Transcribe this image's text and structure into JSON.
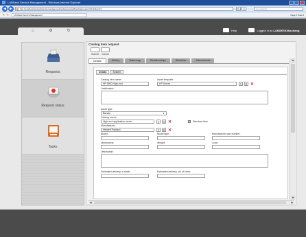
{
  "browser": {
    "window_title": "LANDesk Service Management - Windows Internet Explorer",
    "address": "http://localhost/landesk/servicemanagement/webaccess/wd/ReqStatus.aspx?id=44&ci=21",
    "search_placeholder": "Live Search",
    "tab_title": "LANDesk Service Management",
    "toolbar_right": "Page ▾  Tools ▾"
  },
  "header": {
    "help_label": "Help",
    "logged_in_prefix": "Logged in as",
    "user": "LANDESK\\lbschang"
  },
  "sidebar": {
    "items": [
      {
        "label": "Requests",
        "icon": "inbox-icon"
      },
      {
        "label": "Request status",
        "icon": "request-status-icon"
      },
      {
        "label": "Tasks",
        "icon": "tasks-icon"
      }
    ]
  },
  "main": {
    "title": "Catalog item request",
    "actions": {
      "submit": "Submit",
      "cancel": "Cancel"
    },
    "tabs": [
      "Details",
      "History",
      "Data map",
      "Relationships",
      "Workflow",
      "Attachments"
    ],
    "active_tab": "Details",
    "subtabs": [
      "Details",
      "System"
    ]
  },
  "form": {
    "catalog_item_name_label": "Catalog item name:",
    "catalog_item_name_value": "HP 8000 High-end",
    "asset_template_label": "Asset template:",
    "asset_template_value": "HP Server",
    "justification_label": "Justification:",
    "asset_type_label": "Asset type:",
    "asset_type_value": "Server",
    "catalog_owner_label": "Catalog owner:",
    "catalog_owner_value": "High-end application server",
    "standard_item_label": "Standard item",
    "manufacturer_label": "Manufacturer:",
    "manufacturer_value": "Hewlett Packard",
    "model_label": "Model:",
    "model_type_label": "Model type:",
    "manufacturer_part_label": "Manufacturer part number:",
    "dimensions_label": "Dimensions:",
    "weight_label": "Weight:",
    "color_label": "Color:",
    "description_label": "Description:",
    "est_delivery_in_stock_label": "Estimated delivery, in stock:",
    "est_delivery_out_stock_label": "Estimated delivery, out of stock:"
  },
  "colors": {
    "header_bg": "#4b4b4b",
    "page_bg": "#e9e9e9",
    "delete_red": "#d22222",
    "ie_title_blue": "#1e4f9c"
  }
}
